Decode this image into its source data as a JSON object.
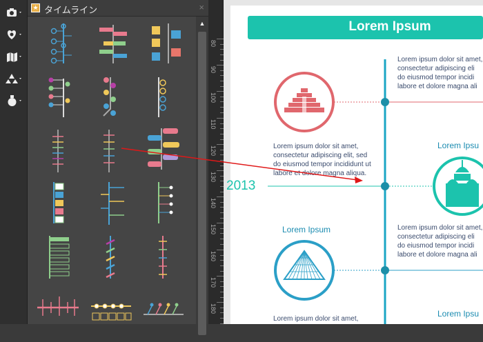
{
  "panel": {
    "title": "タイムライン",
    "close_label": "×",
    "scroll_up_label": "▲"
  },
  "toolbar": {
    "items": [
      "camera-icon",
      "heart-icon",
      "map-icon",
      "shapes-icon",
      "vase-icon"
    ]
  },
  "ruler": {
    "labels": [
      "80",
      "90",
      "100",
      "110",
      "120",
      "130",
      "140",
      "150",
      "160",
      "170",
      "180"
    ]
  },
  "document": {
    "banner_title": "Lorem Ipsum",
    "year_label": "2013",
    "body_right_1": [
      "Lorem ipsum dolor sit amet,",
      "consectetur adipiscing eli",
      "do eiusmod tempor incidi",
      "labore et dolore magna ali"
    ],
    "body_left_1": [
      "Lorem ipsum dolor sit amet,",
      "consectetur adipiscing elit, sed",
      "do eiusmod tempor incididunt ut",
      "labore et dolore magna aliqua."
    ],
    "heading_right_1": "Lorem Ipsu",
    "heading_left_1": "Lorem Ipsum",
    "body_right_2": [
      "Lorem ipsum dolor sit amet,",
      "consectetur adipiscing eli",
      "do eiusmod tempor incidi",
      "labore et dolore magna ali"
    ],
    "heading_right_2": "Lorem Ipsu",
    "body_left_2": [
      "Lorem ipsum dolor sit amet,"
    ]
  },
  "colors": {
    "accent": "#1cc3ad",
    "coral": "#e0676d",
    "blue": "#2b9fc7",
    "arrow": "#e01818"
  }
}
